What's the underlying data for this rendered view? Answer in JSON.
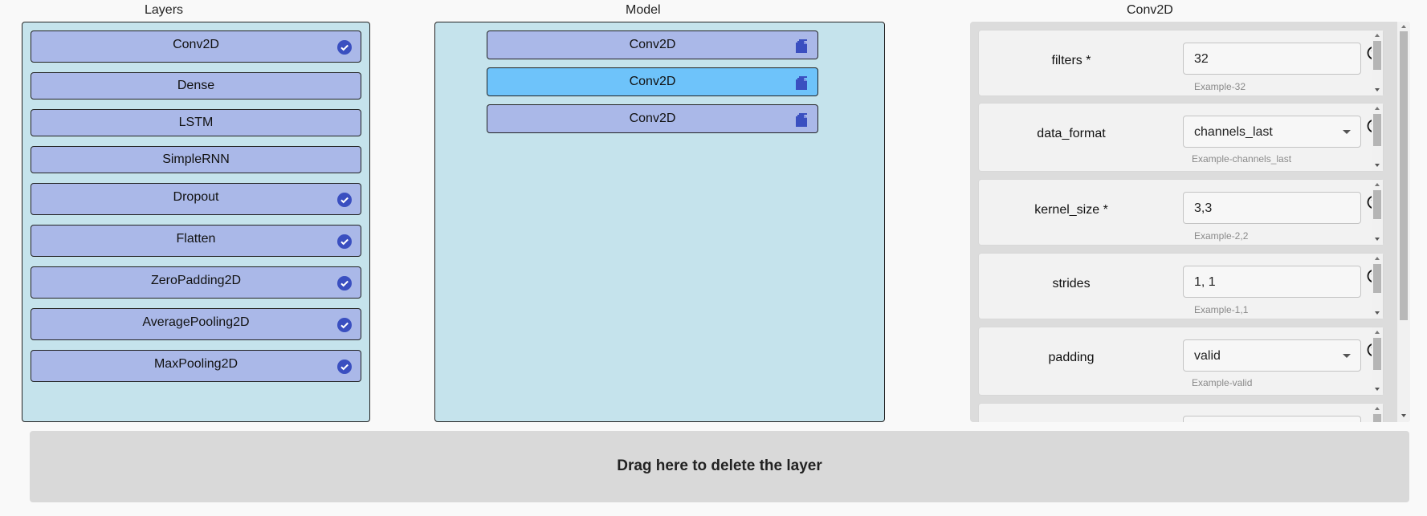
{
  "columns": {
    "layers_title": "Layers",
    "model_title": "Model",
    "params_title": "Conv2D"
  },
  "layers": [
    {
      "label": "Conv2D",
      "checked": true
    },
    {
      "label": "Dense",
      "checked": false
    },
    {
      "label": "LSTM",
      "checked": false
    },
    {
      "label": "SimpleRNN",
      "checked": false
    },
    {
      "label": "Dropout",
      "checked": true
    },
    {
      "label": "Flatten",
      "checked": true
    },
    {
      "label": "ZeroPadding2D",
      "checked": true
    },
    {
      "label": "AveragePooling2D",
      "checked": true
    },
    {
      "label": "MaxPooling2D",
      "checked": true
    }
  ],
  "model": [
    {
      "label": "Conv2D",
      "selected": false,
      "icon": "copy-icon"
    },
    {
      "label": "Conv2D",
      "selected": true,
      "icon": "copy-icon"
    },
    {
      "label": "Conv2D",
      "selected": false,
      "icon": "copy-icon"
    }
  ],
  "params": [
    {
      "label": "filters  *",
      "value": "32",
      "type": "text",
      "example": "Example-32"
    },
    {
      "label": "data_format",
      "value": "channels_last",
      "type": "select",
      "example": "Example-channels_last"
    },
    {
      "label": "kernel_size  *",
      "value": "3,3",
      "type": "text",
      "example": "Example-2,2"
    },
    {
      "label": "strides",
      "value": "1, 1",
      "type": "text",
      "example": "Example-1,1"
    },
    {
      "label": "padding",
      "value": "valid",
      "type": "select",
      "example": "Example-valid"
    }
  ],
  "delete_zone": {
    "text": "Drag here to delete the layer"
  },
  "colors": {
    "panel_bg": "#c5e3ec",
    "layer_bg": "#aab8e8",
    "selected_bg": "#6ec3fa",
    "icon_blue": "#3a4fc0"
  }
}
